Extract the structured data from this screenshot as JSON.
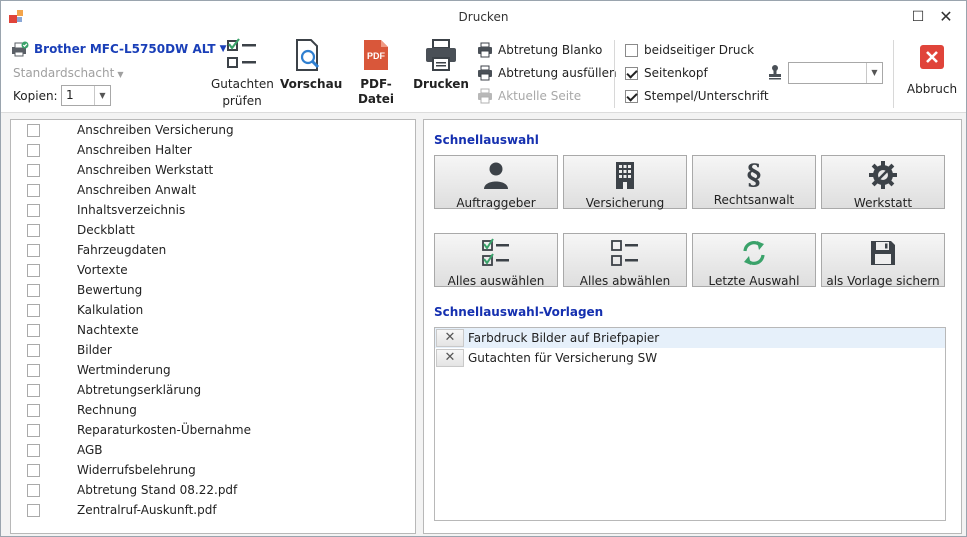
{
  "window": {
    "title": "Drucken",
    "maximize_glyph": "☐",
    "close_glyph": "✕"
  },
  "printer": {
    "name": "Brother MFC-L5750DW ALT",
    "tray": "Standardschacht",
    "copies_label": "Kopien:",
    "copies_value": "1"
  },
  "toolbar": {
    "check_report_line1": "Gutachten",
    "check_report_line2": "prüfen",
    "preview": "Vorschau",
    "pdf": "PDF-Datei",
    "print": "Drucken",
    "assignment_blank": "Abtretung Blanko",
    "assignment_fill": "Abtretung ausfüllen",
    "current_page": "Aktuelle Seite",
    "duplex": "beidseitiger Druck",
    "duplex_checked": false,
    "header": "Seitenkopf",
    "header_checked": true,
    "stamp": "Stempel/Unterschrift",
    "stamp_checked": true,
    "stamp_select_value": "",
    "cancel": "Abbruch",
    "pdf_icon_text": "PDF"
  },
  "documents": [
    "Anschreiben Versicherung",
    "Anschreiben Halter",
    "Anschreiben Werkstatt",
    "Anschreiben Anwalt",
    "Inhaltsverzeichnis",
    "Deckblatt",
    "Fahrzeugdaten",
    "Vortexte",
    "Bewertung",
    "Kalkulation",
    "Nachtexte",
    "Bilder",
    "Wertminderung",
    "Abtretungserklärung",
    "Rechnung",
    "Reparaturkosten-Übernahme",
    "AGB",
    "Widerrufsbelehrung",
    "Abtretung Stand 08.22.pdf",
    "Zentralruf-Auskunft.pdf"
  ],
  "quick": {
    "title": "Schnellauswahl",
    "client": "Auftraggeber",
    "insurance": "Versicherung",
    "lawyer": "Rechtsanwalt",
    "workshop": "Werkstatt",
    "select_all": "Alles auswählen",
    "deselect_all": "Alles abwählen",
    "last_selection": "Letzte Auswahl",
    "save_template": "als Vorlage sichern",
    "paragraph_glyph": "§"
  },
  "templates": {
    "title": "Schnellauswahl-Vorlagen",
    "delete_glyph": "✕",
    "items": [
      "Farbdruck Bilder auf Briefpapier",
      "Gutachten für Versicherung SW"
    ]
  },
  "colors": {
    "accent_blue": "#1530b0",
    "cancel_red": "#e0443a",
    "pdf_red": "#d9573a",
    "refresh_green": "#3aa26a",
    "icon_dark": "#3c4248"
  }
}
